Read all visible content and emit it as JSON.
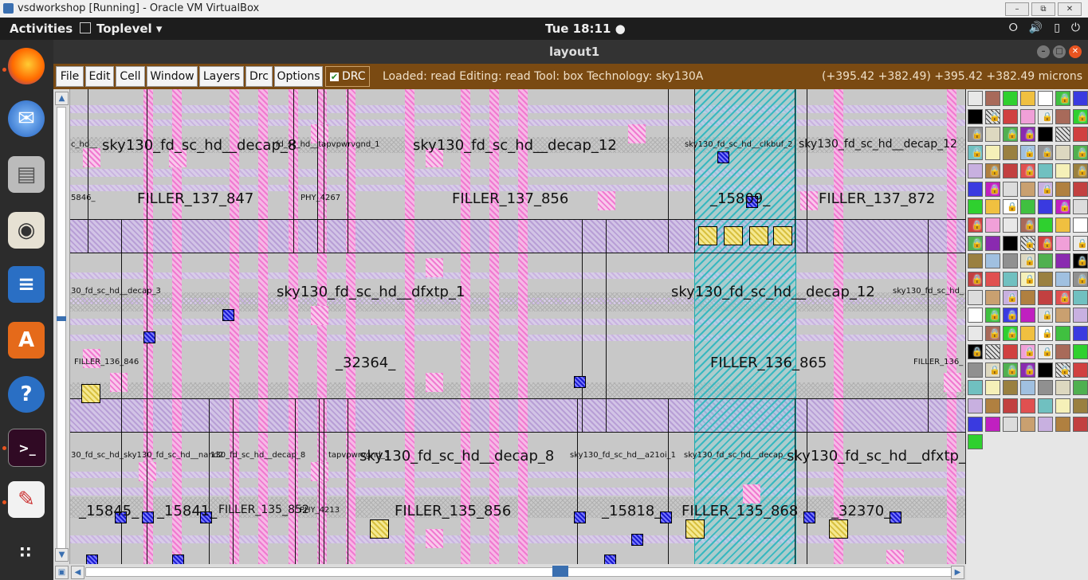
{
  "virtualbox": {
    "title": "vsdworkshop [Running] - Oracle VM VirtualBox",
    "controls": [
      "–",
      "⧉",
      "✕"
    ]
  },
  "gnome": {
    "activities": "Activities",
    "app_menu": "Toplevel ▾",
    "clock": "Tue 18:11 ●",
    "tray": [
      "network-icon",
      "volume-icon",
      "battery-icon",
      "power-icon"
    ]
  },
  "dock": {
    "apps": [
      "firefox-icon",
      "thunderbird-icon",
      "files-icon",
      "rhythmbox-icon",
      "libreoffice-writer-icon",
      "software-center-icon",
      "help-icon",
      "terminal-icon",
      "text-editor-icon",
      "app-grid-icon"
    ]
  },
  "magic": {
    "window_title": "layout1",
    "menu": [
      "File",
      "Edit",
      "Cell",
      "Window",
      "Layers",
      "Drc",
      "Options"
    ],
    "drc_label": "DRC",
    "drc_checked": true,
    "status": "Loaded: read Editing: read Tool: box  Technology: sky130A",
    "coords": "(+395.42 +382.49) +395.42 +382.49 microns"
  },
  "layout": {
    "row1_labels": [
      "c_hd__",
      "sky130_fd_sc_hd__decap_8",
      "fd_sc_hd__tapvpwrvgnd_1",
      "sky130_fd_sc_hd__decap_12",
      "sky130_fd_sc_hd__clkbuf_2",
      "sky130_fd_sc_hd__decap_12"
    ],
    "row1_names": [
      "5846_",
      "FILLER_137_847",
      "PHY_4267",
      "FILLER_137_856",
      "_15809_",
      "FILLER_137_872"
    ],
    "row2_labels": [
      "30_fd_sc_hd__decap_3",
      "sky130_fd_sc_hd__dfxtp_1",
      "sky130_fd_sc_hd__decap_12",
      "sky130_fd_sc_hd_"
    ],
    "row2_names": [
      "FILLER_136_846",
      "_32364_",
      "FILLER_136_865",
      "FILLER_136_"
    ],
    "row3_labels": [
      "30_fd_sc_hd_sky130_fd_sc_hd__nand2",
      "130_fd_sc_hd__decap_8",
      "tapvpwrvgnd_1",
      "sky130_fd_sc_hd__decap_8",
      "sky130_fd_sc_hd__a21oi_1",
      "sky130_fd_sc_hd__decap_",
      "sky130_fd_sc_hd__dfxtp_4"
    ],
    "row3_names": [
      "_15845_",
      "_15841_",
      "FILLER_135_852",
      "PHY_4213",
      "FILLER_135_856",
      "_15818_",
      "FILLER_135_868",
      "_32370_"
    ]
  },
  "colors": {
    "menubar": "#7a4a12",
    "canvas": "#c8c8c8",
    "metal": "#f07ad0",
    "poly": "#c9b3e0",
    "highlight": "#38b8c0"
  }
}
